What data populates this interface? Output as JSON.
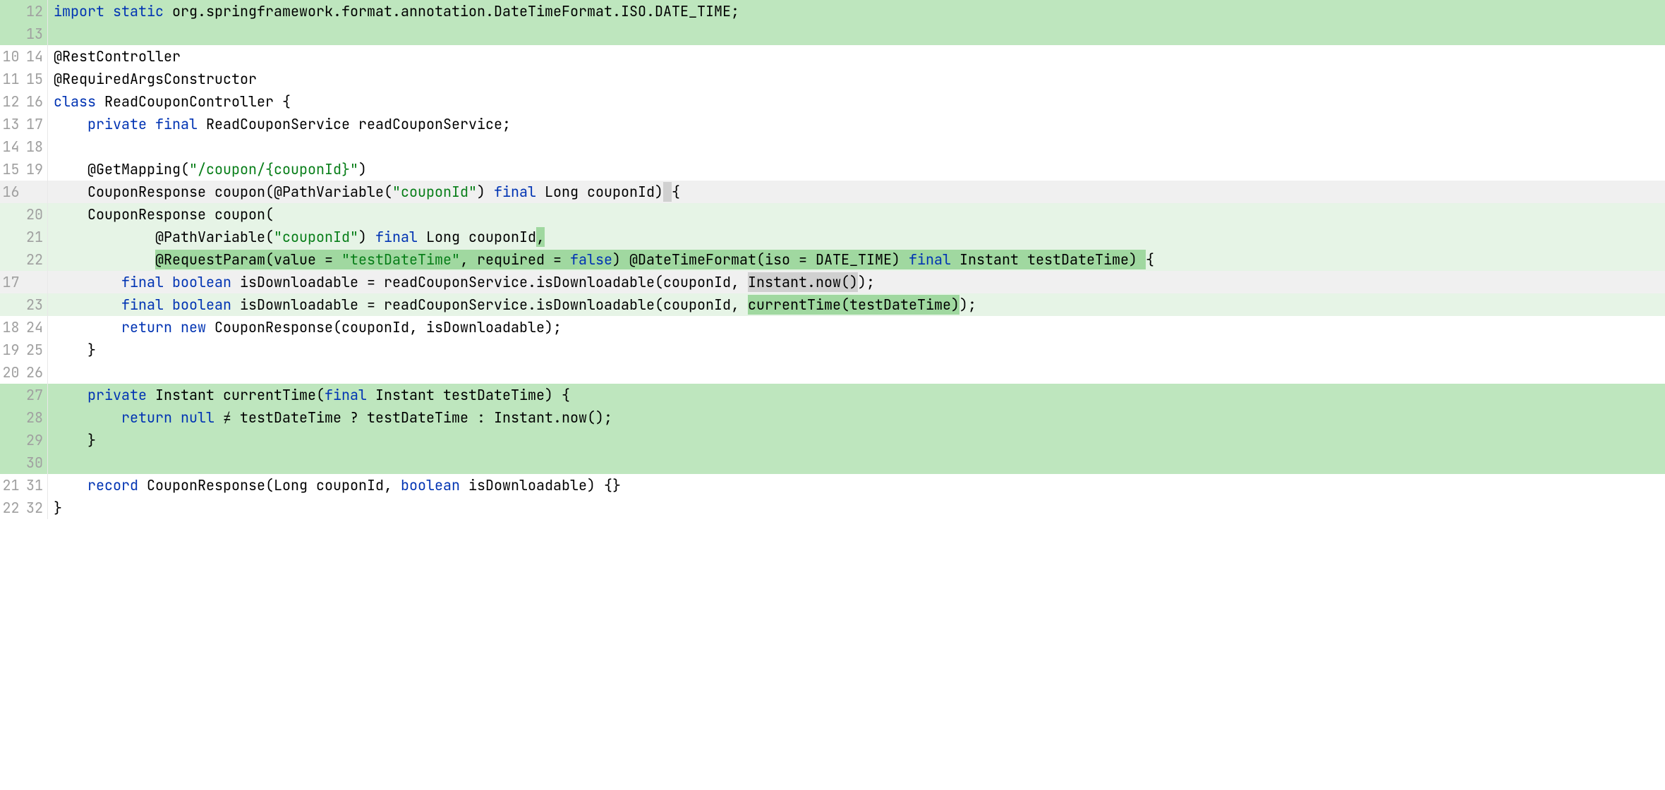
{
  "lines": [
    {
      "oldN": "",
      "newN": "12",
      "type": "add",
      "rstrip": "add",
      "frags": [
        [
          "kw",
          "import "
        ],
        [
          "kw",
          "static "
        ],
        [
          "plain",
          "org.springframework.format.annotation.DateTimeFormat.ISO.DATE_TIME;"
        ]
      ]
    },
    {
      "oldN": "",
      "newN": "13",
      "type": "add",
      "rstrip": "add",
      "frags": [
        [
          "plain",
          ""
        ]
      ]
    },
    {
      "oldN": "10",
      "newN": "14",
      "type": "ctx",
      "rstrip": "",
      "frags": [
        [
          "plain",
          "@RestController"
        ]
      ]
    },
    {
      "oldN": "11",
      "newN": "15",
      "type": "ctx",
      "rstrip": "",
      "frags": [
        [
          "plain",
          "@RequiredArgsConstructor"
        ]
      ]
    },
    {
      "oldN": "12",
      "newN": "16",
      "type": "ctx",
      "rstrip": "",
      "frags": [
        [
          "kw",
          "class "
        ],
        [
          "plain",
          "ReadCouponController {"
        ]
      ]
    },
    {
      "oldN": "13",
      "newN": "17",
      "type": "ctx",
      "rstrip": "",
      "frags": [
        [
          "plain",
          "    "
        ],
        [
          "kw",
          "private final "
        ],
        [
          "plain",
          "ReadCouponService readCouponService;"
        ]
      ]
    },
    {
      "oldN": "14",
      "newN": "18",
      "type": "ctx",
      "rstrip": "",
      "frags": [
        [
          "plain",
          ""
        ]
      ]
    },
    {
      "oldN": "15",
      "newN": "19",
      "type": "ctx",
      "rstrip": "",
      "frags": [
        [
          "plain",
          "    @GetMapping("
        ],
        [
          "str",
          "\"/coupon/{couponId}\""
        ],
        [
          "plain",
          ")"
        ]
      ]
    },
    {
      "oldN": "16",
      "newN": "",
      "type": "del",
      "rstrip": "",
      "frags": [
        [
          "plain",
          "    CouponResponse coupon(@PathVariable("
        ],
        [
          "str",
          "\"couponId\""
        ],
        [
          "plain",
          ") "
        ],
        [
          "kw",
          "final "
        ],
        [
          "plain",
          "Long couponId)"
        ],
        [
          "hl-del",
          " "
        ],
        [
          "plain",
          "{"
        ]
      ]
    },
    {
      "oldN": "",
      "newN": "20",
      "type": "addlite",
      "rstrip": "light",
      "frags": [
        [
          "plain",
          "    CouponResponse coupon("
        ]
      ]
    },
    {
      "oldN": "",
      "newN": "21",
      "type": "addlite",
      "rstrip": "light",
      "frags": [
        [
          "plain",
          "            @PathVariable("
        ],
        [
          "str",
          "\"couponId\""
        ],
        [
          "plain",
          ") "
        ],
        [
          "kw",
          "final "
        ],
        [
          "plain",
          "Long couponId"
        ],
        [
          "hl-add",
          ","
        ]
      ]
    },
    {
      "oldN": "",
      "newN": "22",
      "type": "addlite",
      "rstrip": "light",
      "frags": [
        [
          "plain",
          "            "
        ],
        [
          "hl-add-open",
          ""
        ],
        [
          "plain",
          "@RequestParam(value = "
        ],
        [
          "str",
          "\"testDateTime\""
        ],
        [
          "plain",
          ", required = "
        ],
        [
          "kw",
          "false"
        ],
        [
          "plain",
          ") @DateTimeFormat(iso = DATE_TIME) "
        ],
        [
          "kw",
          "final "
        ],
        [
          "plain",
          "Instant testDateTime) "
        ],
        [
          "hl-add-close",
          ""
        ],
        [
          "plain",
          "{"
        ]
      ]
    },
    {
      "oldN": "17",
      "newN": "",
      "type": "del",
      "rstrip": "",
      "frags": [
        [
          "plain",
          "        "
        ],
        [
          "kw",
          "final boolean "
        ],
        [
          "plain",
          "isDownloadable = readCouponService.isDownloadable(couponId, "
        ],
        [
          "hl-del",
          "Instant.now()"
        ],
        [
          "plain",
          ");"
        ]
      ]
    },
    {
      "oldN": "",
      "newN": "23",
      "type": "addlite",
      "rstrip": "light",
      "frags": [
        [
          "plain",
          "        "
        ],
        [
          "kw",
          "final boolean "
        ],
        [
          "plain",
          "isDownloadable = readCouponService.isDownloadable(couponId, "
        ],
        [
          "hl-add",
          "currentTime(testDateTime)"
        ],
        [
          "plain",
          ");"
        ]
      ]
    },
    {
      "oldN": "18",
      "newN": "24",
      "type": "ctx",
      "rstrip": "",
      "frags": [
        [
          "plain",
          "        "
        ],
        [
          "kw",
          "return new "
        ],
        [
          "plain",
          "CouponResponse(couponId, isDownloadable);"
        ]
      ]
    },
    {
      "oldN": "19",
      "newN": "25",
      "type": "ctx",
      "rstrip": "",
      "frags": [
        [
          "plain",
          "    }"
        ]
      ]
    },
    {
      "oldN": "20",
      "newN": "26",
      "type": "ctx",
      "rstrip": "",
      "frags": [
        [
          "plain",
          ""
        ]
      ]
    },
    {
      "oldN": "",
      "newN": "27",
      "type": "add",
      "rstrip": "add",
      "frags": [
        [
          "plain",
          "    "
        ],
        [
          "kw",
          "private "
        ],
        [
          "plain",
          "Instant currentTime("
        ],
        [
          "kw",
          "final "
        ],
        [
          "plain",
          "Instant testDateTime) {"
        ]
      ]
    },
    {
      "oldN": "",
      "newN": "28",
      "type": "add",
      "rstrip": "add",
      "frags": [
        [
          "plain",
          "        "
        ],
        [
          "kw",
          "return null "
        ],
        [
          "plain",
          "≠ testDateTime ? testDateTime : Instant.now();"
        ]
      ]
    },
    {
      "oldN": "",
      "newN": "29",
      "type": "add",
      "rstrip": "add",
      "frags": [
        [
          "plain",
          "    }"
        ]
      ]
    },
    {
      "oldN": "",
      "newN": "30",
      "type": "add",
      "rstrip": "add",
      "frags": [
        [
          "plain",
          ""
        ]
      ]
    },
    {
      "oldN": "21",
      "newN": "31",
      "type": "ctx",
      "rstrip": "",
      "frags": [
        [
          "plain",
          "    "
        ],
        [
          "kw",
          "record "
        ],
        [
          "plain",
          "CouponResponse(Long couponId, "
        ],
        [
          "kw",
          "boolean "
        ],
        [
          "plain",
          "isDownloadable) {}"
        ]
      ]
    },
    {
      "oldN": "22",
      "newN": "32",
      "type": "ctx",
      "rstrip": "",
      "frags": [
        [
          "plain",
          "}"
        ]
      ]
    }
  ]
}
